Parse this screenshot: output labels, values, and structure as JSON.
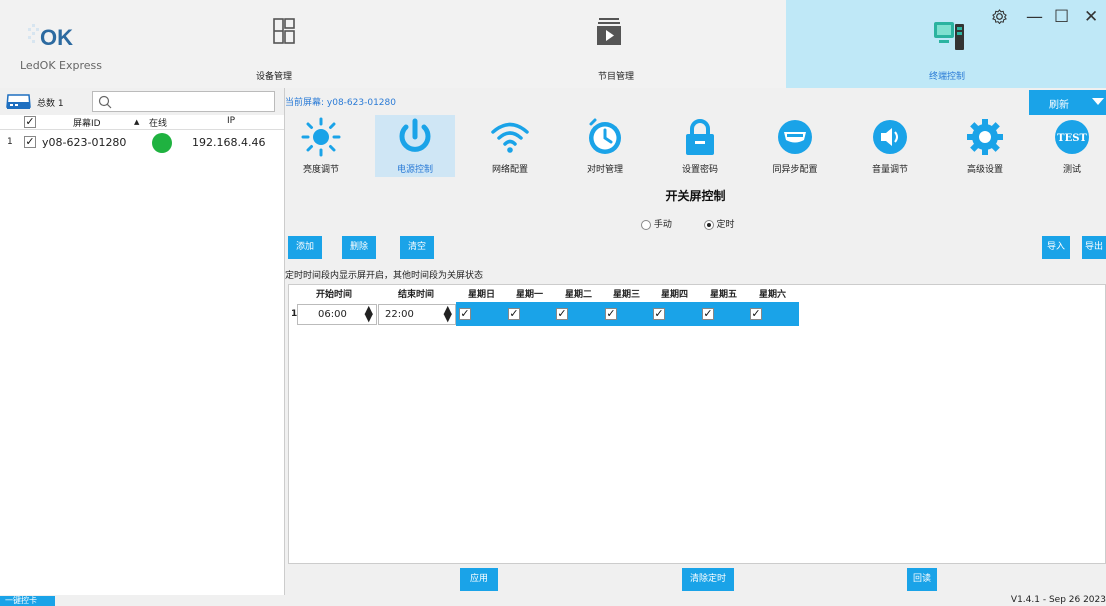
{
  "app": {
    "name": "LedOK Express",
    "logo_text": "OK"
  },
  "nav": {
    "device_tab": "设备管理",
    "program_tab": "节目管理",
    "terminal_tab": "终端控制"
  },
  "window": {
    "settings_icon": "gear-icon",
    "minimize": "—",
    "maximize": "☐",
    "close": "✕"
  },
  "left_panel": {
    "total_label": "总数 1",
    "search_placeholder": "",
    "columns": [
      "屏幕ID",
      "在线",
      "IP"
    ],
    "rows": [
      {
        "index": "1",
        "screen_id": "y08-623-01280",
        "online": true,
        "ip": "192.168.4.46"
      }
    ]
  },
  "main": {
    "current_screen": "当前屏幕: y08-623-01280",
    "refresh_label": "刷新",
    "functions": [
      {
        "label": "亮度调节",
        "icon": "sun-icon"
      },
      {
        "label": "电源控制",
        "icon": "power-icon"
      },
      {
        "label": "网络配置",
        "icon": "wifi-icon"
      },
      {
        "label": "对时管理",
        "icon": "clock-icon"
      },
      {
        "label": "设置密码",
        "icon": "lock-icon"
      },
      {
        "label": "同异步配置",
        "icon": "hdmi-icon"
      },
      {
        "label": "音量调节",
        "icon": "volume-icon"
      },
      {
        "label": "高级设置",
        "icon": "gear-icon"
      },
      {
        "label": "测试",
        "icon": "test-icon"
      }
    ],
    "panel_title": "开关屏控制",
    "modes": {
      "manual": "手动",
      "scheduled": "定时",
      "selected": "scheduled"
    },
    "buttons": {
      "add": "添加",
      "delete": "删除",
      "clear": "清空",
      "import": "导入",
      "export": "导出"
    },
    "note": "定时时间段内显示屏开启，其他时间段为关屏状态",
    "schedule": {
      "columns": [
        "开始时间",
        "结束时间",
        "星期日",
        "星期一",
        "星期二",
        "星期三",
        "星期四",
        "星期五",
        "星期六"
      ],
      "rows": [
        {
          "index": "1",
          "start": "06:00",
          "end": "22:00",
          "days": [
            true,
            true,
            true,
            true,
            true,
            true,
            true
          ]
        }
      ]
    },
    "bottom": {
      "apply": "应用",
      "clear_schedule": "清除定时",
      "readback": "回读"
    }
  },
  "footer": {
    "one_key": "一键控卡",
    "version": "V1.4.1 - Sep 26 2023"
  },
  "colors": {
    "accent": "#1aa3e8",
    "online": "#1fb240",
    "active_tab": "#bfe8f7"
  }
}
